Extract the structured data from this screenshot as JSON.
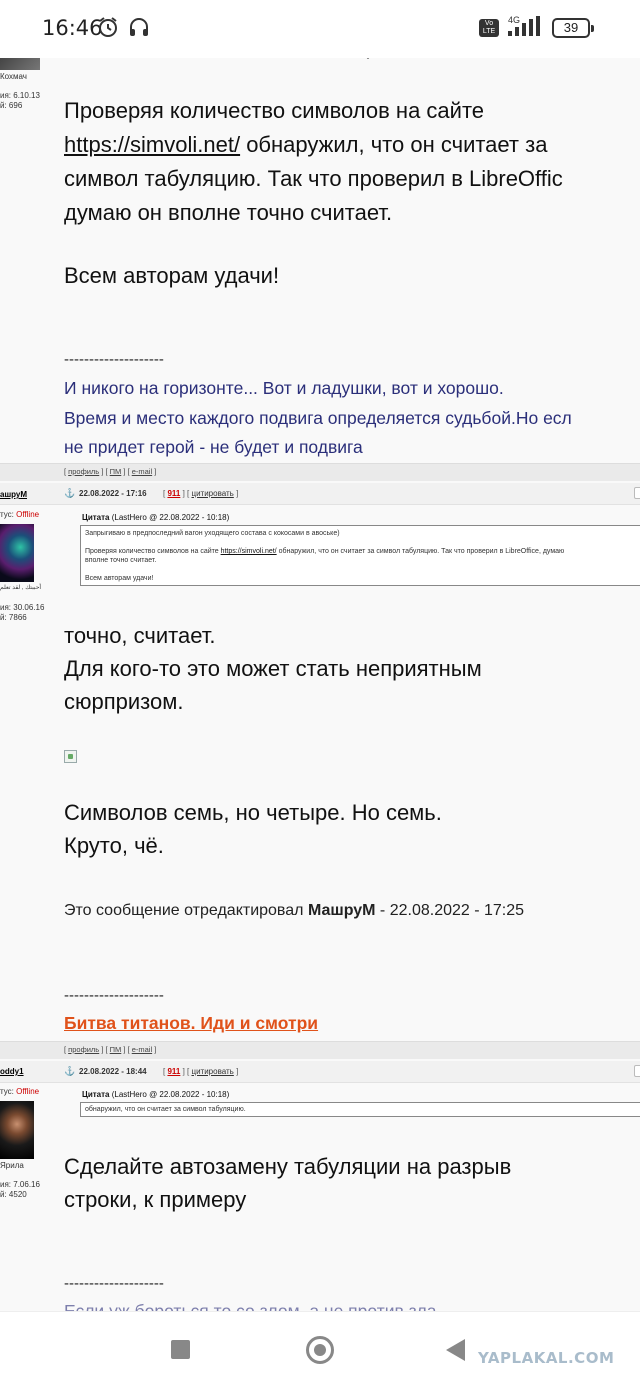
{
  "status": {
    "time": "16:46",
    "volte": "Vo LTE",
    "network": "4G",
    "battery": "39"
  },
  "post1": {
    "author_short": "Кохмач",
    "reg": "ия: 6.10.13",
    "posts": "й: 696",
    "text_top": "состава с кокосами в авоське)",
    "p1_line1_pre": "Проверяя количество символов на сайте",
    "p1_link": "https://simvoli.net/",
    "p1_line2_post": " обнаружил, что он считает за",
    "p1_line3": "символ табуляцию. Так что проверил в LibreOffic",
    "p1_line4": "думаю он вполне точно считает.",
    "p2": "Всем авторам удачи!",
    "separator": "--------------------",
    "sig1": "И никого на горизонте... Вот и ладушки, вот и хорошо.",
    "sig2": "Время и место каждого подвига определяется судьбой.Но есл",
    "sig3": "не придет герой - не будет и подвига"
  },
  "postbar": {
    "profile": "профиль",
    "pm": "ПМ",
    "email": "e-mail"
  },
  "post2": {
    "author": "ашруМ",
    "status_label": "тус:",
    "status": "Offline",
    "caption": "أحببتك , لقد تعلم",
    "reg": "ия: 30.06.16",
    "posts": "й: 7866",
    "anchor": "⚓",
    "date": "22.08.2022 - 17:16",
    "num": "911",
    "cite": "цитировать",
    "quote_label": "Цитата",
    "quote_meta": "(LastHero @ 22.08.2022 - 10:18)",
    "quote_l1": "Запрыгиваю в предпоследний вагон уходящего состава с кокосами в авоське)",
    "quote_l2_pre": "Проверяя количество символов на сайте ",
    "quote_link": "https://simvoli.net/",
    "quote_l2_post": " обнаружил, что он считает за символ табуляцию. Так что проверил в LibreOffice, думаю",
    "quote_l3": "вполне точно считает.",
    "quote_l4": "Всем авторам удачи!",
    "t1": "точно, считает.",
    "t2": "Для кого-то это может стать неприятным",
    "t3": "сюрпризом.",
    "t4": "Символов семь, но четыре. Но семь.",
    "t5": "Круто, чё.",
    "edited_pre": "Это сообщение отредактировал ",
    "edited_author": "МашруМ",
    "edited_post": " - 22.08.2022 - 17:25",
    "separator": "--------------------",
    "sig": "Битва титанов. Иди и смотри"
  },
  "post3": {
    "author": "oddy1",
    "status_label": "тус:",
    "status": "Offline",
    "caption": "Ярила",
    "reg": "ия: 7.06.16",
    "posts": "й: 4520",
    "anchor": "⚓",
    "date": "22.08.2022 - 18:44",
    "num": "911",
    "cite": "цитировать",
    "quote_label": "Цитата",
    "quote_meta": "(LastHero @ 22.08.2022 - 10:18)",
    "quote_l1": "обнаружил, что он считает за символ табуляцию.",
    "t1": "Сделайте автозамену табуляции на разрыв",
    "t2": "строки, к примеру",
    "separator": "--------------------",
    "faded": "Если уж бороться то со злом, а не против зла"
  },
  "navbar": {
    "logo": "YAPLAKAL.COM"
  }
}
